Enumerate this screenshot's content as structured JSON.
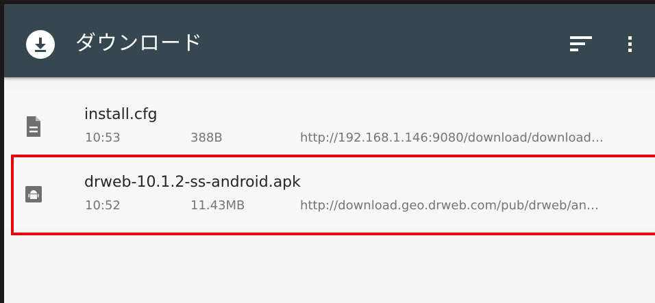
{
  "appbar": {
    "title": "ダウンロード",
    "background": "#37474f",
    "app_icon": "download-icon",
    "actions": [
      "sort-icon",
      "more-vert-icon"
    ]
  },
  "downloads": [
    {
      "name": "install.cfg",
      "time": "10:53",
      "size": "388B",
      "url": "http://192.168.1.146:9080/download/download…",
      "icon": "document-icon"
    },
    {
      "name": "drweb-10.1.2-ss-android.apk",
      "time": "10:52",
      "size": "11.43MB",
      "url": "http://download.geo.drweb.com/pub/drweb/an…",
      "icon": "android-icon",
      "highlighted": true
    }
  ],
  "highlight_color": "#e8000f"
}
